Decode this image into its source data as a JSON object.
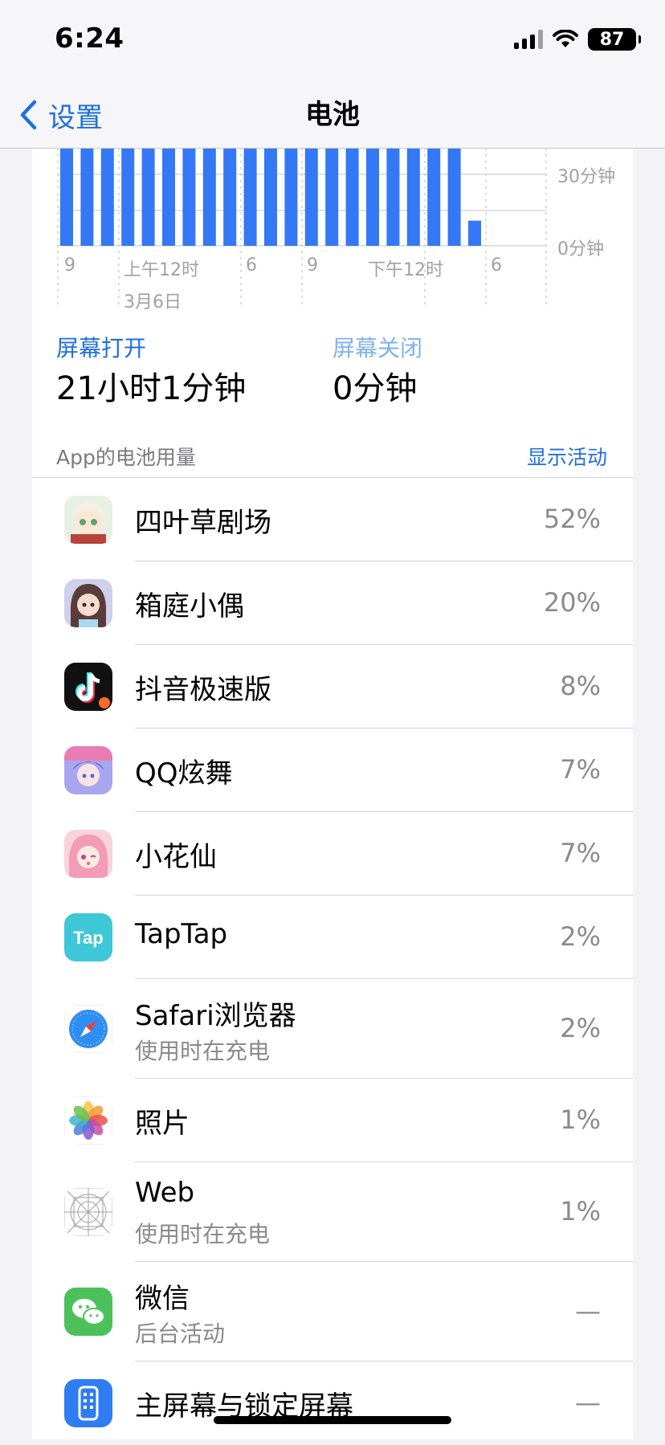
{
  "status_bar": {
    "time": "6:24",
    "battery": "87",
    "icons": [
      "signal-icon",
      "wifi-icon",
      "battery-icon"
    ]
  },
  "nav": {
    "back_label": "设置",
    "title": "电池",
    "back_icon": "chevron-left-icon"
  },
  "chart_data": {
    "type": "bar",
    "y_tick_labels": [
      "30分钟",
      "0分钟"
    ],
    "x_tick_labels": [
      "9",
      "上午12时",
      "6",
      "9",
      "下午12时",
      "6"
    ],
    "date_label": "3月6日",
    "values_fraction_of_top_visible": [
      1,
      1,
      1,
      1,
      1,
      1,
      1,
      1,
      1,
      1,
      1,
      1,
      1,
      1,
      1,
      1,
      1,
      1,
      1,
      1,
      0.23
    ],
    "bar_color": "#3478f6"
  },
  "screen_on": {
    "label": "屏幕打开",
    "value": "21小时1分钟"
  },
  "screen_off": {
    "label": "屏幕关闭",
    "value": "0分钟"
  },
  "section": {
    "title": "App的电池用量",
    "action": "显示活动"
  },
  "apps": [
    {
      "name": "四叶草剧场",
      "sub": "",
      "pct": "52%",
      "icon": "siyecao-icon"
    },
    {
      "name": "箱庭小偶",
      "sub": "",
      "pct": "20%",
      "icon": "xiangting-icon"
    },
    {
      "name": "抖音极速版",
      "sub": "",
      "pct": "8%",
      "icon": "douyin-icon"
    },
    {
      "name": "QQ炫舞",
      "sub": "",
      "pct": "7%",
      "icon": "qqxuanwu-icon"
    },
    {
      "name": "小花仙",
      "sub": "",
      "pct": "7%",
      "icon": "xiaohuaxian-icon"
    },
    {
      "name": "TapTap",
      "sub": "",
      "pct": "2%",
      "icon": "taptap-icon",
      "icon_text": "Tap"
    },
    {
      "name": "Safari浏览器",
      "sub": "使用时在充电",
      "pct": "2%",
      "icon": "safari-icon"
    },
    {
      "name": "照片",
      "sub": "",
      "pct": "1%",
      "icon": "photos-icon"
    },
    {
      "name": "Web",
      "sub": "使用时在充电",
      "pct": "1%",
      "icon": "web-icon"
    },
    {
      "name": "微信",
      "sub": "后台活动",
      "pct": "—",
      "icon": "wechat-icon"
    },
    {
      "name": "主屏幕与锁定屏幕",
      "sub": "",
      "pct": "—",
      "icon": "home-lock-screen-icon"
    }
  ]
}
